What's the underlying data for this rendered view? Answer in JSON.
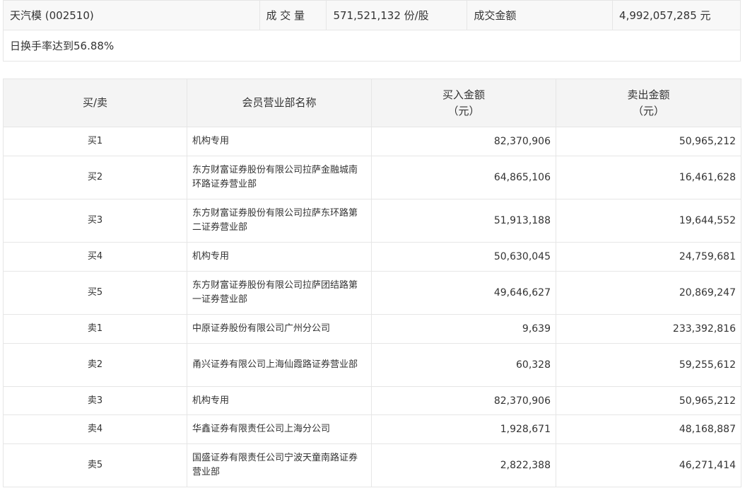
{
  "summary": {
    "stock": "天汽模 (002510)",
    "volume_label": "成 交 量",
    "volume_value": "571,521,132 份/股",
    "amount_label": "成交金额",
    "amount_value": "4,992,057,285 元",
    "reason": "日换手率达到56.88%"
  },
  "table": {
    "headers": {
      "side": "买/卖",
      "member": "会员营业部名称",
      "buy_line1": "买入金额",
      "buy_line2": "（元）",
      "sell_line1": "卖出金额",
      "sell_line2": "（元）"
    },
    "rows": [
      {
        "side": "买1",
        "member": "机构专用",
        "buy": "82,370,906",
        "sell": "50,965,212"
      },
      {
        "side": "买2",
        "member": "东方财富证券股份有限公司拉萨金融城南环路证券营业部",
        "buy": "64,865,106",
        "sell": "16,461,628"
      },
      {
        "side": "买3",
        "member": "东方财富证券股份有限公司拉萨东环路第二证券营业部",
        "buy": "51,913,188",
        "sell": "19,644,552"
      },
      {
        "side": "买4",
        "member": "机构专用",
        "buy": "50,630,045",
        "sell": "24,759,681"
      },
      {
        "side": "买5",
        "member": "东方财富证券股份有限公司拉萨团结路第一证券营业部",
        "buy": "49,646,627",
        "sell": "20,869,247"
      },
      {
        "side": "卖1",
        "member": "中原证券股份有限公司广州分公司",
        "buy": "9,639",
        "sell": "233,392,816"
      },
      {
        "side": "卖2",
        "member": "甬兴证券有限公司上海仙霞路证券营业部",
        "buy": "60,328",
        "sell": "59,255,612"
      },
      {
        "side": "卖3",
        "member": "机构专用",
        "buy": "82,370,906",
        "sell": "50,965,212"
      },
      {
        "side": "卖4",
        "member": "华鑫证券有限责任公司上海分公司",
        "buy": "1,928,671",
        "sell": "48,168,887"
      },
      {
        "side": "卖5",
        "member": "国盛证券有限责任公司宁波天童南路证券营业部",
        "buy": "2,822,388",
        "sell": "46,271,414"
      }
    ]
  }
}
